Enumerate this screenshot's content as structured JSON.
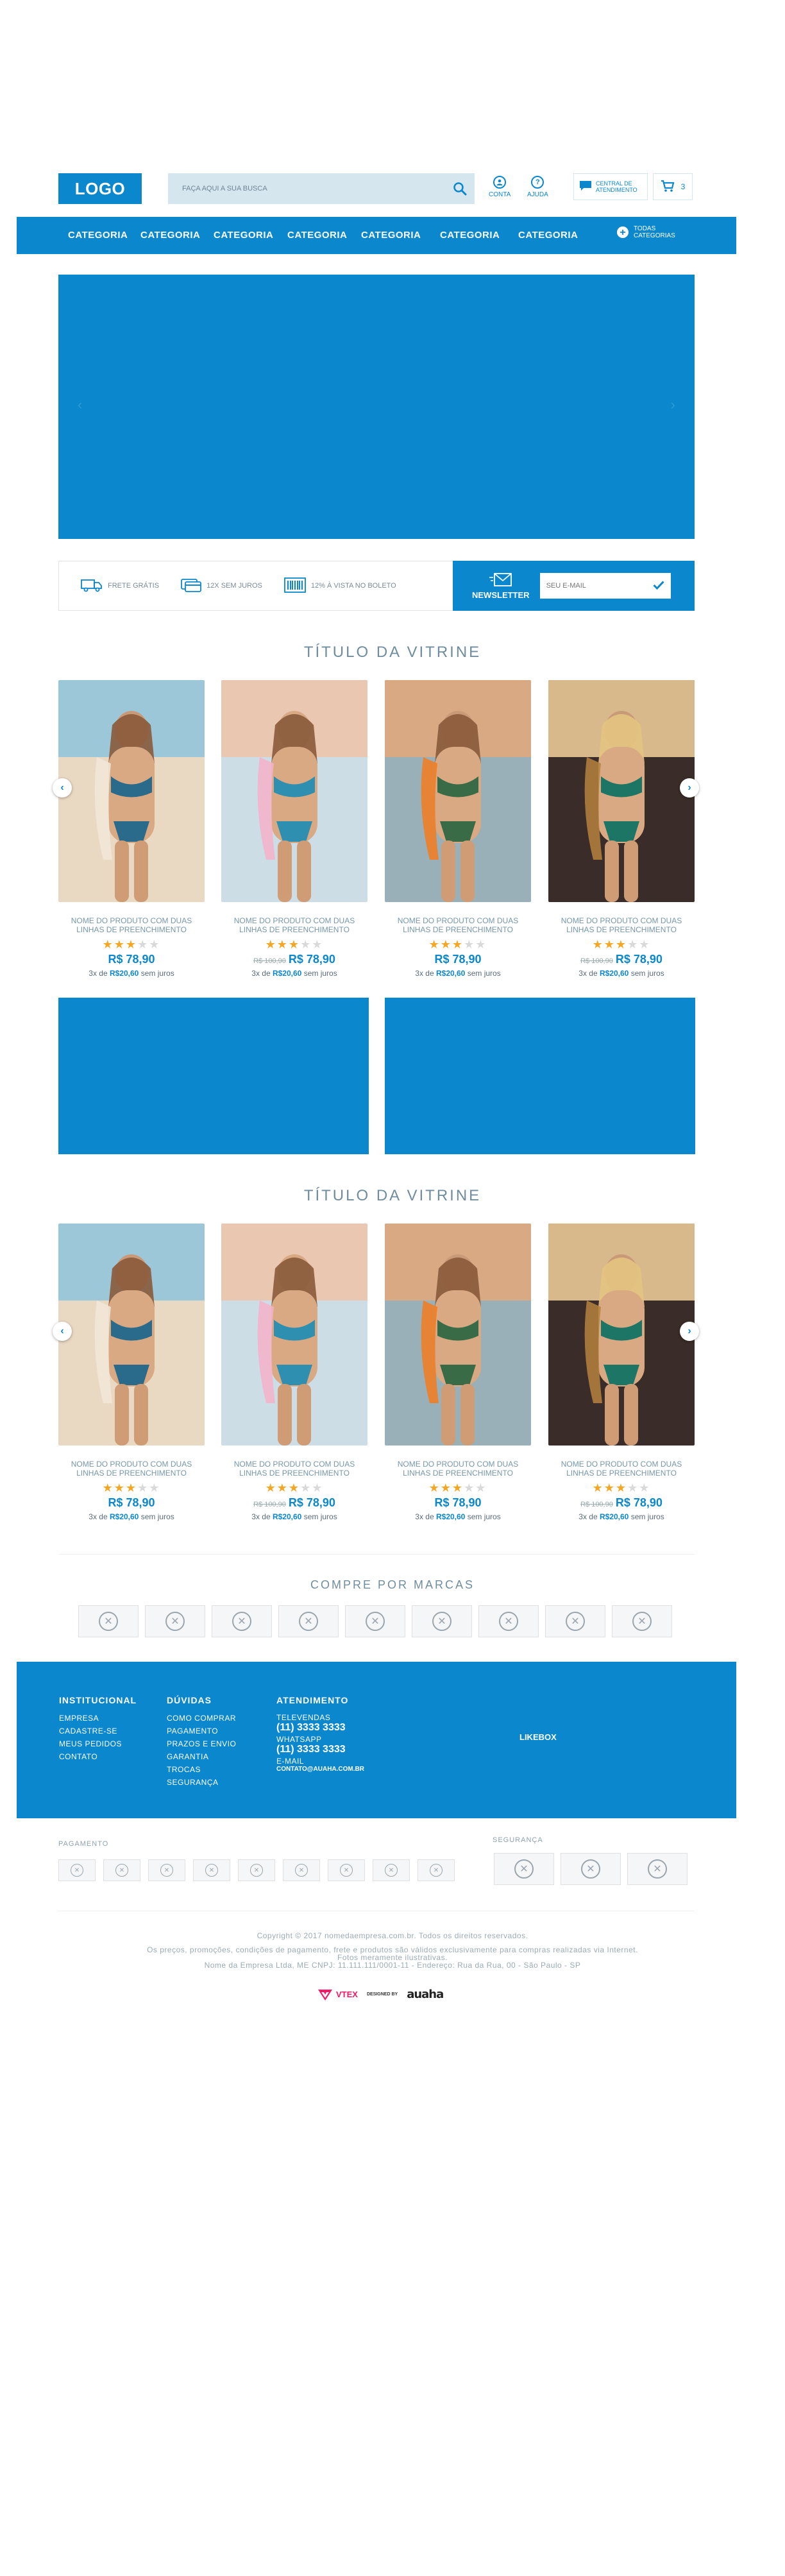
{
  "header": {
    "logo": "LOGO",
    "search_placeholder": "FAÇA AQUI A SUA BUSCA",
    "account": "CONTA",
    "help": "AJUDA",
    "central_line1": "CENTRAL DE",
    "central_line2": "ATENDIMENTO",
    "cart_count": "3"
  },
  "nav": {
    "items": [
      "CATEGORIA",
      "CATEGORIA",
      "CATEGORIA",
      "CATEGORIA",
      "CATEGORIA",
      "CATEGORIA",
      "CATEGORIA"
    ],
    "all_line1": "TODAS",
    "all_line2": "CATEGORIAS"
  },
  "benefits": [
    "FRETE GRÁTIS",
    "12X SEM JUROS",
    "12% À VISTA NO BOLETO"
  ],
  "newsletter": {
    "label": "NEWSLETTER",
    "placeholder": "SEU E-MAIL"
  },
  "shelves": [
    {
      "title": "TÍTULO DA VITRINE",
      "products": [
        {
          "name": "NOME DO PRODUTO COM DUAS LINHAS DE PREENCHIMENTO",
          "rating": 3,
          "old_price": "",
          "price": "R$ 78,90",
          "inst_prefix": "3x de",
          "inst_value": "R$20,60",
          "inst_suffix": "sem juros"
        },
        {
          "name": "NOME DO PRODUTO COM DUAS LINHAS DE PREENCHIMENTO",
          "rating": 3,
          "old_price": "R$ 100,90",
          "price": "R$ 78,90",
          "inst_prefix": "3x de",
          "inst_value": "R$20,60",
          "inst_suffix": "sem juros"
        },
        {
          "name": "NOME DO PRODUTO COM DUAS LINHAS DE PREENCHIMENTO",
          "rating": 3,
          "old_price": "",
          "price": "R$ 78,90",
          "inst_prefix": "3x de",
          "inst_value": "R$20,60",
          "inst_suffix": "sem juros"
        },
        {
          "name": "NOME DO PRODUTO COM DUAS LINHAS DE PREENCHIMENTO",
          "rating": 3,
          "old_price": "R$ 100,90",
          "price": "R$ 78,90",
          "inst_prefix": "3x de",
          "inst_value": "R$20,60",
          "inst_suffix": "sem juros"
        }
      ]
    },
    {
      "title": "TÍTULO DA VITRINE",
      "products": [
        {
          "name": "NOME DO PRODUTO COM DUAS LINHAS DE PREENCHIMENTO",
          "rating": 3,
          "old_price": "",
          "price": "R$ 78,90",
          "inst_prefix": "3x de",
          "inst_value": "R$20,60",
          "inst_suffix": "sem juros"
        },
        {
          "name": "NOME DO PRODUTO COM DUAS LINHAS DE PREENCHIMENTO",
          "rating": 3,
          "old_price": "R$ 100,90",
          "price": "R$ 78,90",
          "inst_prefix": "3x de",
          "inst_value": "R$20,60",
          "inst_suffix": "sem juros"
        },
        {
          "name": "NOME DO PRODUTO COM DUAS LINHAS DE PREENCHIMENTO",
          "rating": 3,
          "old_price": "",
          "price": "R$ 78,90",
          "inst_prefix": "3x de",
          "inst_value": "R$20,60",
          "inst_suffix": "sem juros"
        },
        {
          "name": "NOME DO PRODUTO COM DUAS LINHAS DE PREENCHIMENTO",
          "rating": 3,
          "old_price": "R$ 100,90",
          "price": "R$ 78,90",
          "inst_prefix": "3x de",
          "inst_value": "R$20,60",
          "inst_suffix": "sem juros"
        }
      ]
    }
  ],
  "brands_title": "COMPRE POR MARCAS",
  "footer": {
    "institutional": {
      "title": "INSTITUCIONAL",
      "links": [
        "EMPRESA",
        "CADASTRE-SE",
        "MEUS PEDIDOS",
        "CONTATO"
      ]
    },
    "doubts": {
      "title": "DÚVIDAS",
      "links": [
        "COMO COMPRAR",
        "PAGAMENTO",
        "PRAZOS E ENVIO",
        "GARANTIA",
        "TROCAS",
        "SEGURANÇA"
      ]
    },
    "service": {
      "title": "ATENDIMENTO",
      "tele_label": "TELEVENDAS",
      "tele_phone": "(11) 3333 3333",
      "whats_label": "WHATSAPP",
      "whats_phone": "(11) 3333 3333",
      "email_label": "E-MAIL",
      "email": "CONTATO@AUAHA.COM.BR"
    },
    "likebox": "LIKEBOX"
  },
  "payment_title": "PAGAMENTO",
  "security_title": "SEGURANÇA",
  "legal": {
    "copyright": "Copyright © 2017 nomedaempresa.com.br. Todos os direitos reservados.",
    "line2": "Os preços, promoções, condições de pagamento, frete e produtos são válidos exclusivamente para compras realizadas via Internet.",
    "line3": "Fotos meramente ilustrativas.",
    "line4": "Nome da Empresa Ltda, ME CNPJ: 11.111.111/0001-11 - Endereço: Rua da Rua, 00 - São Paulo - SP"
  },
  "credits": {
    "platform": "VTEX",
    "designed_by": "DESIGNED BY",
    "agency": "auaha"
  },
  "colors": {
    "primary": "#0a87cd",
    "search_bg": "#d6e6ef",
    "star": "#f5a623"
  }
}
